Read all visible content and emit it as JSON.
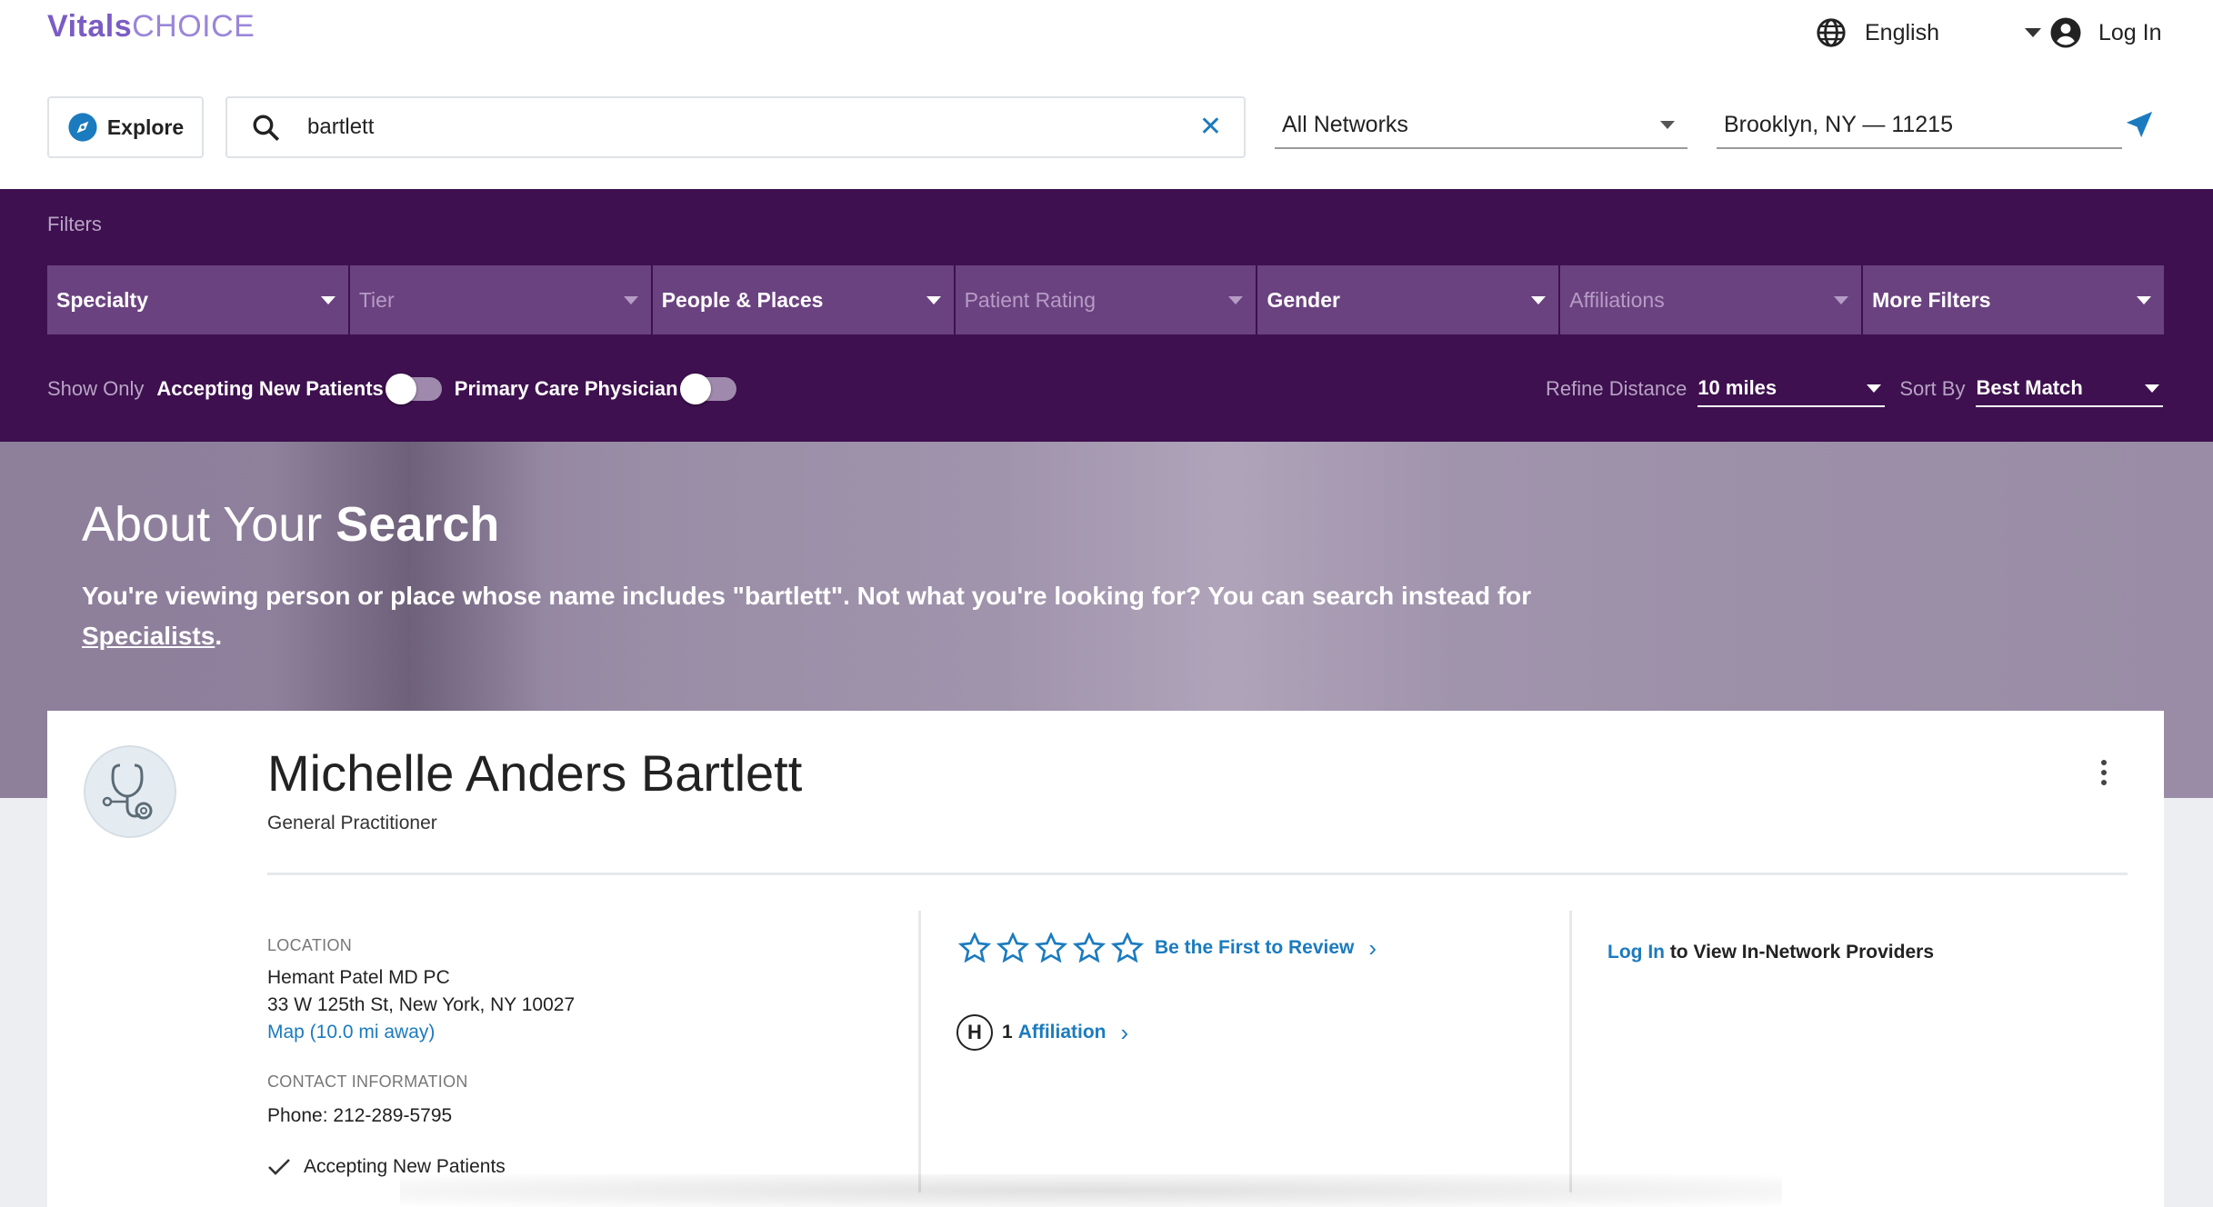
{
  "brand": {
    "logo_bold": "Vitals",
    "logo_light": "CHOICE",
    "accent": "#3e104f",
    "link_color": "#1b7bbf"
  },
  "header": {
    "language": "English",
    "login_label": "Log In",
    "explore_label": "Explore",
    "search": {
      "value": "bartlett",
      "placeholder": ""
    },
    "network": "All Networks",
    "location": "Brooklyn, NY — 11215"
  },
  "filters": {
    "title": "Filters",
    "items": [
      {
        "label": "Specialty",
        "enabled": true
      },
      {
        "label": "Tier",
        "enabled": false
      },
      {
        "label": "People & Places",
        "enabled": true
      },
      {
        "label": "Patient Rating",
        "enabled": false
      },
      {
        "label": "Gender",
        "enabled": true
      },
      {
        "label": "Affiliations",
        "enabled": false
      },
      {
        "label": "More Filters",
        "enabled": true
      }
    ],
    "show_only_label": "Show Only",
    "toggle_accepting": "Accepting New Patients",
    "toggle_pcp": "Primary Care Physician",
    "refine_label": "Refine Distance",
    "distance": "10 miles",
    "sort_label": "Sort By",
    "sort": "Best Match"
  },
  "hero": {
    "title_light": "About Your ",
    "title_bold": "Search",
    "text": "You're viewing person or place whose name includes \"bartlett\". Not what you're looking for? You can search instead for ",
    "link": "Specialists",
    "text_end": "."
  },
  "provider": {
    "name": "Michelle Anders Bartlett",
    "specialty": "General Practitioner",
    "location_label": "LOCATION",
    "practice": "Hemant Patel MD PC",
    "address": "33 W 125th St, New York, NY 10027",
    "map_link": "Map (10.0 mi away)",
    "contact_label": "CONTACT INFORMATION",
    "phone": "Phone: 212-289-5795",
    "accepting": "Accepting New Patients",
    "review_cta": "Be the First to Review",
    "affiliation_count": "1",
    "affiliation_label": "Affiliation",
    "innetwork_link": "Log In",
    "innetwork_text": " to View In-Network Providers"
  }
}
